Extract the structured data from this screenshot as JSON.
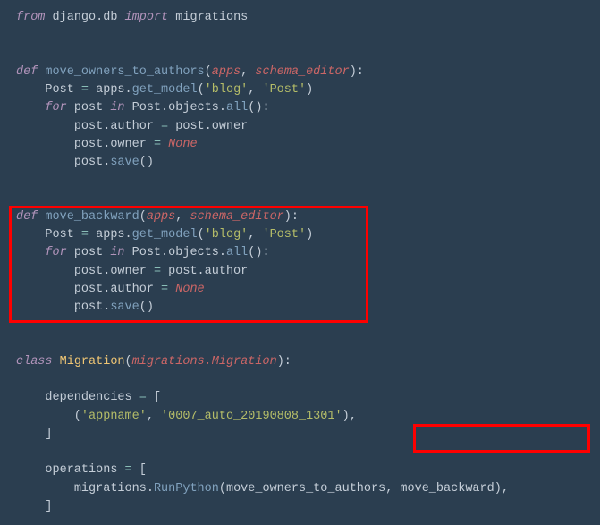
{
  "code": {
    "import_line": {
      "from": "from",
      "pkg": "django.db",
      "import": "import",
      "mod": "migrations"
    },
    "fn1": {
      "def": "def",
      "name": "move_owners_to_authors",
      "p1": "apps",
      "p2": "schema_editor",
      "l1a": "Post ",
      "l1b": "=",
      "l1c": " apps.",
      "l1d": "get_model",
      "l1s1": "'blog'",
      "l1s2": "'Post'",
      "l2a": "for",
      "l2b": " post ",
      "l2c": "in",
      "l2d": " Post.objects.",
      "l2e": "all",
      "l3": "post.author ",
      "l3eq": "=",
      "l3b": " post.owner",
      "l4": "post.owner ",
      "l4eq": "=",
      "l4none": "None",
      "l5a": "post.",
      "l5b": "save"
    },
    "fn2": {
      "def": "def",
      "name": "move_backward",
      "p1": "apps",
      "p2": "schema_editor",
      "l1a": "Post ",
      "l1b": "=",
      "l1c": " apps.",
      "l1d": "get_model",
      "l1s1": "'blog'",
      "l1s2": "'Post'",
      "l2a": "for",
      "l2b": " post ",
      "l2c": "in",
      "l2d": " Post.objects.",
      "l2e": "all",
      "l3": "post.owner ",
      "l3eq": "=",
      "l3b": " post.author",
      "l4": "post.author ",
      "l4eq": "=",
      "l4none": "None",
      "l5a": "post.",
      "l5b": "save"
    },
    "class": {
      "kw": "class",
      "name": "Migration",
      "base": "migrations.Migration",
      "deps_label": "dependencies ",
      "eq": "=",
      "brkt_open": " [",
      "dep_s1": "'appname'",
      "dep_s2": "'0007_auto_20190808_1301'",
      "brkt_close": "]",
      "ops_label": "operations ",
      "run_a": "migrations.",
      "run_b": "RunPython",
      "arg1": "move_owners_to_authors",
      "arg2": "move_backward"
    }
  },
  "highlights": {
    "box1_desc": "red box around move_backward function",
    "box2_desc": "red box around move_backward argument"
  }
}
